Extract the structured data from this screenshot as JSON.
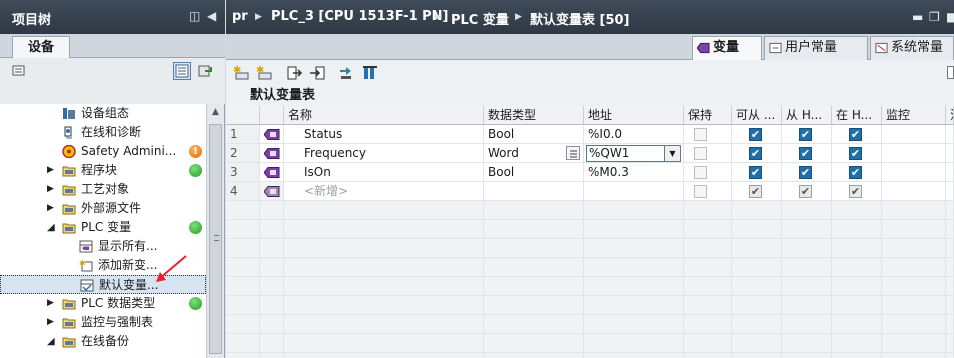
{
  "left_pane": {
    "title": "项目树",
    "tab": "设备",
    "tree": [
      {
        "label": "设备组态",
        "icon": "device-config-icon",
        "indent": 2
      },
      {
        "label": "在线和诊断",
        "icon": "online-diagnostics-icon",
        "indent": 2
      },
      {
        "label": "Safety Admini...",
        "icon": "safety-icon",
        "indent": 2,
        "status": "warning"
      },
      {
        "label": "程序块",
        "icon": "folder-icon",
        "indent": 1,
        "status": "ok",
        "expandable": true
      },
      {
        "label": "工艺对象",
        "icon": "folder-icon",
        "indent": 1,
        "expandable": true
      },
      {
        "label": "外部源文件",
        "icon": "folder-icon",
        "indent": 1,
        "expandable": true
      },
      {
        "label": "PLC 变量",
        "icon": "folder-icon",
        "indent": 1,
        "status": "ok",
        "expanded": true
      },
      {
        "label": "显示所有...",
        "icon": "tag-table-icon",
        "indent": 2
      },
      {
        "label": "添加新变...",
        "icon": "add-tag-table-icon",
        "indent": 2
      },
      {
        "label": "默认变量...",
        "icon": "default-tag-table-icon",
        "indent": 2,
        "selected": true
      },
      {
        "label": "PLC 数据类型",
        "icon": "folder-icon",
        "indent": 1,
        "status": "ok",
        "expandable": true
      },
      {
        "label": "监控与强制表",
        "icon": "folder-icon",
        "indent": 1,
        "expandable": true
      },
      {
        "label": "在线备份",
        "icon": "folder-icon",
        "indent": 1,
        "expanded": true
      }
    ]
  },
  "breadcrumb": {
    "items": [
      "pr",
      "PLC_3 [CPU 1513F-1 PN]",
      "PLC 变量",
      "默认变量表 [50]"
    ]
  },
  "tabs": [
    {
      "label": "变量",
      "active": true
    },
    {
      "label": "用户常量"
    },
    {
      "label": "系统常量"
    }
  ],
  "table": {
    "name": "默认变量表",
    "columns": [
      "",
      "",
      "名称",
      "数据类型",
      "地址",
      "保持",
      "可从 ...",
      "从 H...",
      "在 H...",
      "监控",
      "注"
    ],
    "rows": [
      {
        "num": "1",
        "name": "Status",
        "type": "Bool",
        "address": "%I0.0",
        "retain": false,
        "acc": true,
        "wri": true,
        "vis": true
      },
      {
        "num": "2",
        "name": "Frequency",
        "type": "Word",
        "address": "%QW1",
        "retain": false,
        "acc": true,
        "wri": true,
        "vis": true,
        "editing": true
      },
      {
        "num": "3",
        "name": "IsOn",
        "type": "Bool",
        "address": "%M0.3",
        "retain": false,
        "acc": true,
        "wri": true,
        "vis": true
      },
      {
        "num": "4",
        "name": "<新增>",
        "type": "",
        "address": "",
        "placeholder": true
      }
    ]
  },
  "colors": {
    "titlebar": "#2f3945",
    "checkbox_checked": "#1f6fa8",
    "status_ok": "#1e9e1e",
    "status_warning": "#e26a00",
    "annotation_arrow": "#e8202a"
  }
}
